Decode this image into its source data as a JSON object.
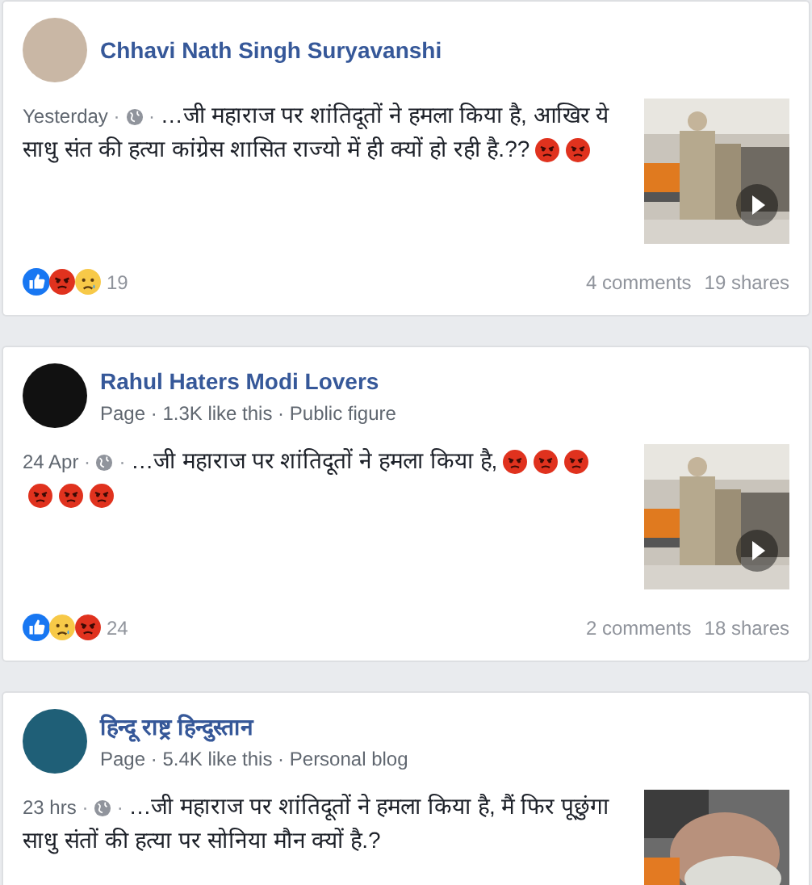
{
  "posts": [
    {
      "author": "Chhavi Nath Singh Suryavanshi",
      "time": "Yesterday",
      "separator": "·",
      "text": "…जी महाराज पर शांतिदूतों ने हमला किया है, आखिर ये साधु संत की हत्या कांग्रेस शासित राज्यो में ही क्यों हो रही है.??",
      "emojis": [
        {
          "kind": "angry"
        },
        {
          "kind": "angry"
        }
      ],
      "thumbnail": {
        "kind": "video"
      },
      "reactions": [
        {
          "kind": "like"
        },
        {
          "kind": "angry"
        },
        {
          "kind": "sad"
        }
      ],
      "reaction_count": "19",
      "comments": "4 comments",
      "shares": "19 shares"
    },
    {
      "author": "Rahul Haters Modi Lovers",
      "meta": "Page · 1.3K like this · Public figure",
      "time": "24 Apr",
      "separator": "·",
      "text": "…जी महाराज पर शांतिदूतों ने हमला किया है,",
      "emojis": [
        {
          "kind": "angry"
        },
        {
          "kind": "angry"
        },
        {
          "kind": "angry"
        },
        {
          "kind": "angry"
        },
        {
          "kind": "angry"
        },
        {
          "kind": "angry"
        }
      ],
      "thumbnail": {
        "kind": "video"
      },
      "reactions": [
        {
          "kind": "like"
        },
        {
          "kind": "sad"
        },
        {
          "kind": "angry"
        }
      ],
      "reaction_count": "24",
      "comments": "2 comments",
      "shares": "18 shares"
    },
    {
      "author": "हिन्दू राष्ट्र हिन्दुस्तान",
      "meta": "Page · 5.4K like this · Personal blog",
      "time": "23 hrs",
      "separator": "·",
      "text": "…जी महाराज पर शांतिदूतों ने हमला किया है, मैं फिर पूछुंगा साधु संतों की हत्या पर सोनिया मौन क्यों है.?"
    }
  ]
}
